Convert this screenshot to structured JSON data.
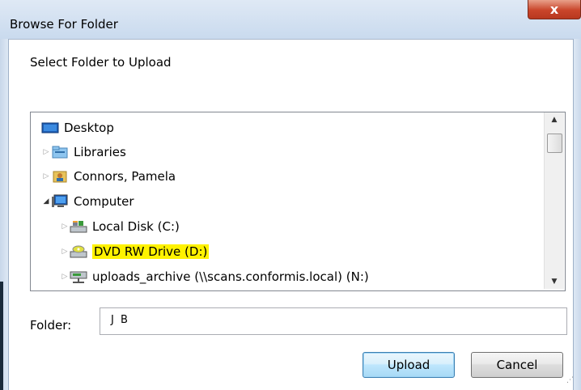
{
  "window": {
    "title": "Browse For Folder",
    "close_glyph": "x"
  },
  "prompt": "Select Folder to Upload",
  "tree": {
    "items": [
      {
        "label": "Desktop",
        "icon": "desktop-icon",
        "expander": ""
      },
      {
        "label": "Libraries",
        "icon": "libraries-icon",
        "expander": "▷"
      },
      {
        "label": "Connors, Pamela",
        "icon": "user-folder-icon",
        "expander": "▷"
      },
      {
        "label": "Computer",
        "icon": "computer-icon",
        "expander": "◢"
      },
      {
        "label": "Local Disk (C:)",
        "icon": "local-disk-icon",
        "expander": "▷"
      },
      {
        "label": "DVD RW Drive (D:)",
        "icon": "dvd-drive-icon",
        "expander": "▷",
        "highlighted": true
      },
      {
        "label": "uploads_archive (\\\\scans.conformis.local) (N:)",
        "icon": "network-drive-icon",
        "expander": "▷"
      }
    ]
  },
  "folder": {
    "label": "Folder:",
    "value": "J B"
  },
  "buttons": {
    "upload": "Upload",
    "cancel": "Cancel"
  },
  "colors": {
    "highlight": "#fff200",
    "titlebar": "#c9daee",
    "close": "#c9452a"
  }
}
